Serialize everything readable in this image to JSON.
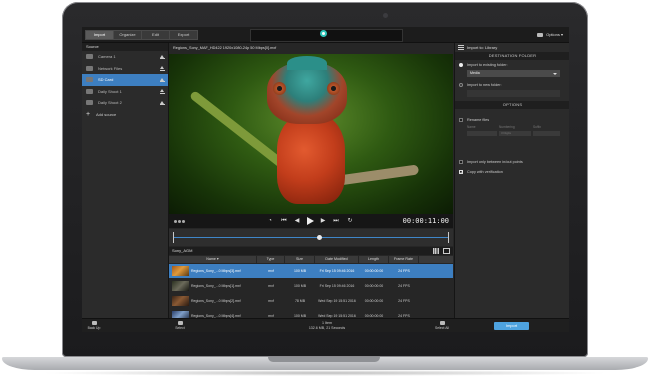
{
  "toolbar": {
    "tabs": [
      "Import",
      "Organize",
      "Edit",
      "Export"
    ],
    "options_label": "Options"
  },
  "source_panel": {
    "header": "Source",
    "items": [
      "Camera 1",
      "Network Files",
      "SD Card",
      "Daily Shoot 1",
      "Daily Shoot 2"
    ],
    "selected_index": 2,
    "add_label": "Add source"
  },
  "player": {
    "clip_title": "Regions_Sony_MAF_HD422 1920x1080-24p 50 Mbps[0].mxf",
    "timecode": "00:00:11:00",
    "timeline_position": 0.53
  },
  "browser": {
    "folder": "Sony_AGM",
    "columns": [
      "Name",
      "Type",
      "Size",
      "Date Modified",
      "Length",
      "Frame Rate"
    ],
    "rows": [
      {
        "name": "Regions_Sony_...0 Mbps[3].mxf",
        "type": "mxf",
        "size": "100 MB",
        "date": "Fri Sep 15 09:46 2016",
        "length": "00:00:00:00",
        "fps": "24 FPS"
      },
      {
        "name": "Regions_Sony_...0 Mbps[1].mxf",
        "type": "mxf",
        "size": "100 MB",
        "date": "Fri Sep 15 09:46 2016",
        "length": "00:00:00:00",
        "fps": "24 FPS"
      },
      {
        "name": "Regions_Sony_...0 Mbps[2].mxf",
        "type": "mxf",
        "size": "78 MB",
        "date": "Wed Sep 19 15:51 2016",
        "length": "00:00:00:00",
        "fps": "24 FPS"
      },
      {
        "name": "Regions_Sony_...0 Mbps[4].mxf",
        "type": "mxf",
        "size": "100 MB",
        "date": "Wed Sep 19 15:51 2016",
        "length": "00:00:00:00",
        "fps": "24 FPS"
      }
    ]
  },
  "import_panel": {
    "import_to": "Import to: Library",
    "destination_header": "DESTINATION FOLDER",
    "existing_folder": "Import to existing folder:",
    "existing_value": "Media",
    "new_folder": "Import to new folder:",
    "options_header": "OPTIONS",
    "rename": "Rename files",
    "rn_labels": [
      "Name",
      "Numbering",
      "Suffix"
    ],
    "rn_value": "3 Digits",
    "in_out": "Import only between in/out points",
    "verify": "Copy with verification"
  },
  "bottom_bar": {
    "back": "Back Up",
    "select": "Select",
    "summary_line1": "1 Item",
    "summary_line2": "132.6 MB, 21 Seconds",
    "select_all": "Select All",
    "import": "Import"
  },
  "colors": {
    "accent": "#3d7fc1",
    "import_button": "#4ea3e0",
    "app_logo": "#2fc4b9"
  }
}
